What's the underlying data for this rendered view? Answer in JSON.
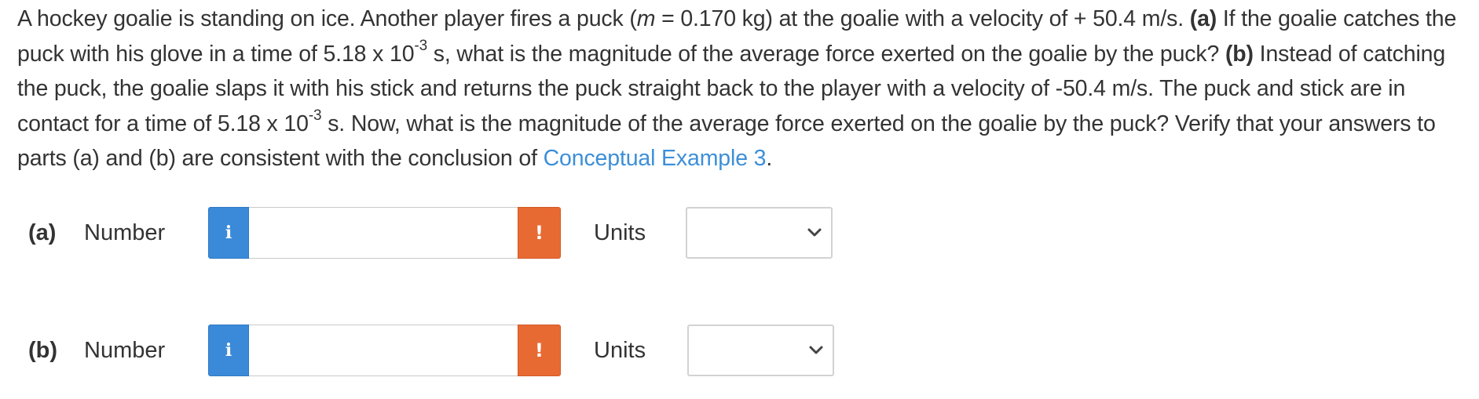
{
  "question": {
    "t1": "A hockey goalie is standing on ice. Another player fires a puck (",
    "m_symbol": "m",
    "t2": " = 0.170 kg) at the goalie with a velocity of + 50.4 m/s. ",
    "part_a_label": "(a)",
    "t3": " If the goalie catches the puck with his glove in a time of 5.18 x 10",
    "exp1": "-3",
    "t4": " s, what is the magnitude of the average force exerted on the goalie by the puck? ",
    "part_b_label": "(b)",
    "t5": " Instead of catching the puck, the goalie slaps it with his stick and returns the puck straight back to the player with a velocity of -50.4 m/s. The puck and stick are in contact for a time of 5.18 x 10",
    "exp2": "-3",
    "t6": " s. Now, what is the magnitude of the average force exerted on the goalie by the puck? Verify that your answers to parts (a) and (b) are consistent with the conclusion of ",
    "link_text": "Conceptual Example 3",
    "t7": "."
  },
  "answers": [
    {
      "part": "(a)",
      "number_label": "Number",
      "info_icon": "i",
      "input_value": "",
      "warning_icon": "!",
      "units_label": "Units",
      "units_selected": ""
    },
    {
      "part": "(b)",
      "number_label": "Number",
      "info_icon": "i",
      "input_value": "",
      "warning_icon": "!",
      "units_label": "Units",
      "units_selected": ""
    }
  ],
  "colors": {
    "text": "#333333",
    "link": "#3d8fd8",
    "info_button": "#3b8ad9",
    "warning_badge": "#e86a33",
    "border": "#c9c9c9"
  }
}
